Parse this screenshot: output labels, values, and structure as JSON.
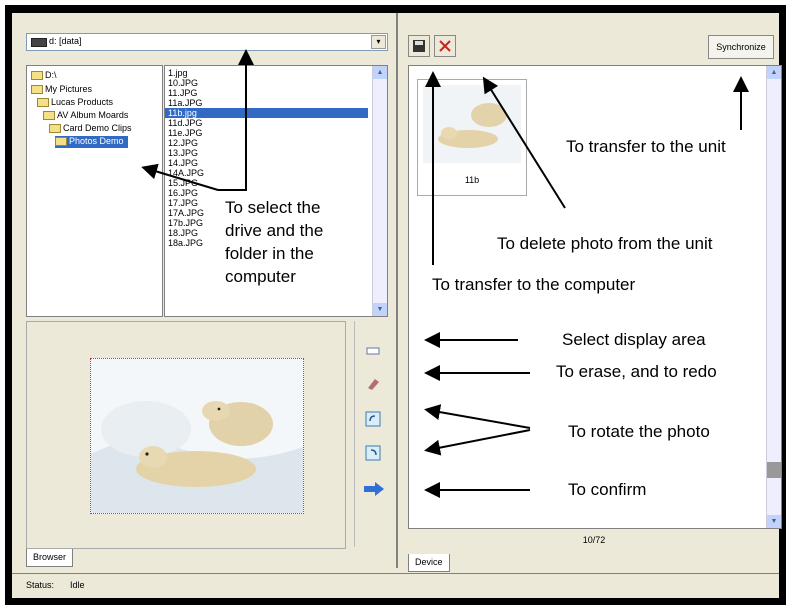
{
  "left": {
    "drive": "d: [data]",
    "tree": [
      "D:\\",
      "My Pictures",
      "Lucas Products",
      "AV Album Moards",
      "Card Demo Clips",
      "Photos Demo"
    ],
    "files": [
      "1.jpg",
      "10.JPG",
      "11.JPG",
      "11a.JPG",
      "11b.jpg",
      "11d.JPG",
      "11e.JPG",
      "12.JPG",
      "13.JPG",
      "14.JPG",
      "14A.JPG",
      "15.JPG",
      "16.JPG",
      "17.JPG",
      "17A.JPG",
      "17b.JPG",
      "18.JPG",
      "18a.JPG"
    ],
    "selected_file_index": 4,
    "tab": "Browser",
    "tools": [
      "select-area-icon",
      "eraser-icon",
      "rotate-left-icon",
      "rotate-right-icon",
      "confirm-arrow-icon"
    ]
  },
  "right": {
    "sync_label": "Synchronize",
    "thumb_caption": "11b",
    "page_count": "10/72",
    "tab": "Device"
  },
  "status": {
    "label": "Status:",
    "value": "Idle"
  },
  "annotations": {
    "select_drive": "To select the drive and the folder in the computer",
    "transfer_unit": "To transfer to the unit",
    "delete_photo": "To delete photo from the unit",
    "transfer_computer": "To transfer to the computer",
    "select_area": "Select display area",
    "erase_redo": "To erase, and to redo",
    "rotate": "To rotate the photo",
    "confirm": "To confirm"
  },
  "colors": {
    "selection": "#316ac5",
    "delete": "#cc2222",
    "confirm": "#2f6fd6"
  }
}
